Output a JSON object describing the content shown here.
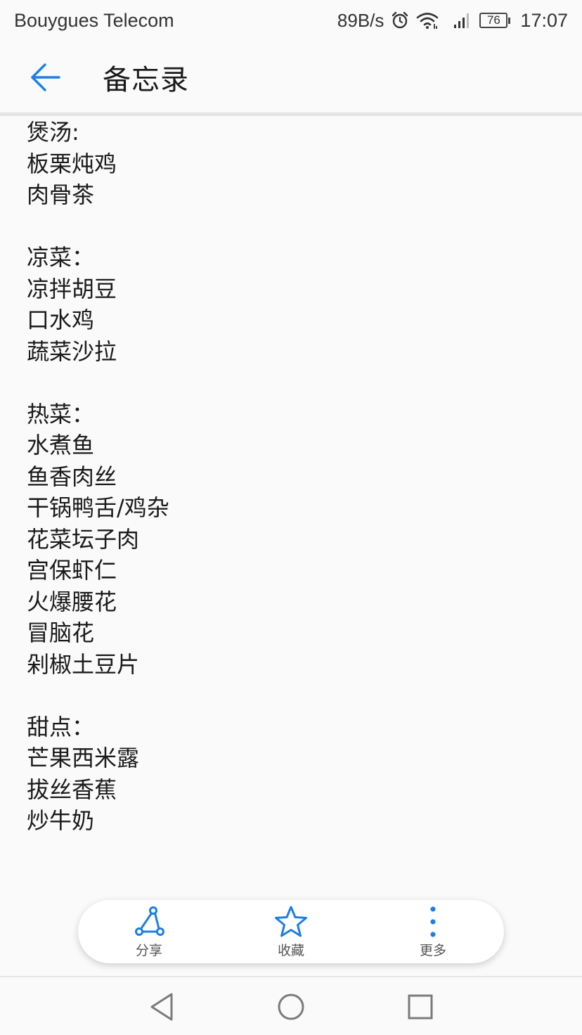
{
  "status_bar": {
    "carrier": "Bouygues Telecom",
    "network_speed": "89B/s",
    "battery_level": "76",
    "time": "17:07",
    "icons": [
      "alarm-icon",
      "wifi-icon",
      "signal-icon",
      "battery-icon"
    ]
  },
  "app_bar": {
    "title": "备忘录",
    "back_icon": "arrow-left-icon",
    "accent_color": "#1e7ee4"
  },
  "note": {
    "lines": [
      "煲汤:",
      "板栗炖鸡",
      "肉骨茶",
      "",
      "凉菜：",
      "凉拌胡豆",
      "口水鸡",
      "蔬菜沙拉",
      "",
      "热菜：",
      "水煮鱼",
      "鱼香肉丝",
      "干锅鸭舌/鸡杂",
      "花菜坛子肉",
      "宫保虾仁",
      "火爆腰花",
      "冒脑花",
      "剁椒土豆片",
      "",
      "甜点：",
      "芒果西米露",
      "拔丝香蕉",
      "炒牛奶"
    ]
  },
  "action_bar": {
    "share_label": "分享",
    "favorite_label": "收藏",
    "more_label": "更多",
    "icon_color": "#1e7ee4"
  },
  "nav_bar": {
    "icons": [
      "back-triangle-icon",
      "home-circle-icon",
      "recents-square-icon"
    ]
  }
}
